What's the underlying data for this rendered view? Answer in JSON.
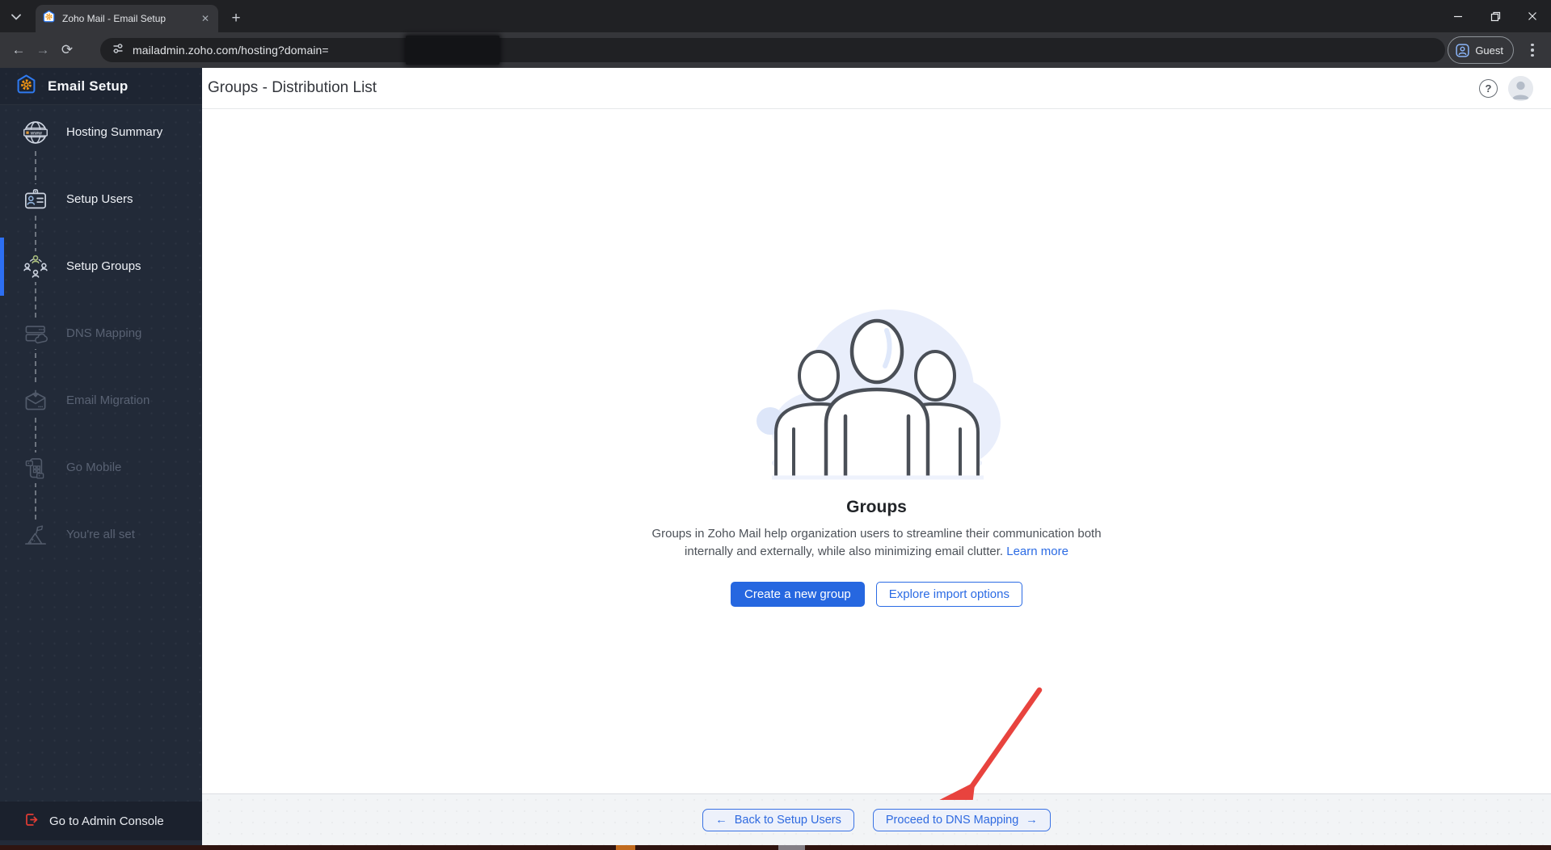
{
  "window": {
    "tab_title": "Zoho Mail - Email Setup",
    "url": "mailadmin.zoho.com/hosting?domain=",
    "profile_label": "Guest"
  },
  "icons": {
    "new_tab": "+",
    "close_tab": "✕",
    "back": "←",
    "forward": "→",
    "reload": "⟳",
    "help": "?",
    "minimize": "─",
    "close_window": "✕"
  },
  "sidebar": {
    "app_title": "Email Setup",
    "items": [
      {
        "label": "Hosting Summary",
        "state": "done"
      },
      {
        "label": "Setup Users",
        "state": "done"
      },
      {
        "label": "Setup Groups",
        "state": "active"
      },
      {
        "label": "DNS Mapping",
        "state": "pending"
      },
      {
        "label": "Email Migration",
        "state": "pending"
      },
      {
        "label": "Go Mobile",
        "state": "pending"
      },
      {
        "label": "You're all set",
        "state": "pending"
      }
    ],
    "footer_link": "Go to Admin Console"
  },
  "header": {
    "title": "Groups - Distribution List"
  },
  "content": {
    "heading": "Groups",
    "description_line1": "Groups in Zoho Mail help organization users to streamline their communication both",
    "description_line2": "internally and externally, while also minimizing email clutter.",
    "learn_more_label": "Learn more",
    "create_button": "Create a new group",
    "import_button": "Explore import options"
  },
  "footer": {
    "back_arrow": "←",
    "back_label": "Back to Setup Users",
    "proceed_label": "Proceed to DNS Mapping",
    "proceed_arrow": "→"
  },
  "colors": {
    "accent_blue": "#2b6be4",
    "sidebar_bg": "#222a38",
    "annotation_red": "#e8433e",
    "admin_link_red": "#e23c34"
  }
}
